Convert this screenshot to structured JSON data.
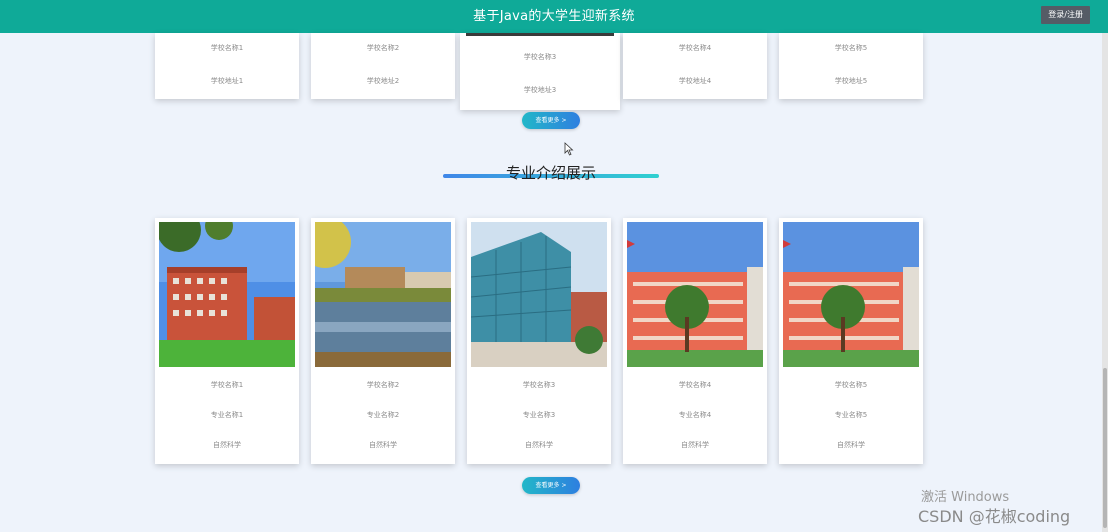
{
  "header": {
    "title": "基于Java的大学生迎新系统",
    "login_label": "登录/注册"
  },
  "schools": [
    {
      "name": "学校名称1",
      "address": "学校地址1"
    },
    {
      "name": "学校名称2",
      "address": "学校地址2"
    },
    {
      "name": "学校名称3",
      "address": "学校地址3"
    },
    {
      "name": "学校名称4",
      "address": "学校地址4"
    },
    {
      "name": "学校名称5",
      "address": "学校地址5"
    }
  ],
  "more_label": "查看更多 >",
  "section": {
    "title": "专业介绍展示"
  },
  "majors": [
    {
      "school": "学校名称1",
      "major": "专业名称1",
      "category": "自然科学"
    },
    {
      "school": "学校名称2",
      "major": "专业名称2",
      "category": "自然科学"
    },
    {
      "school": "学校名称3",
      "major": "专业名称3",
      "category": "自然科学"
    },
    {
      "school": "学校名称4",
      "major": "专业名称4",
      "category": "自然科学"
    },
    {
      "school": "学校名称5",
      "major": "专业名称5",
      "category": "自然科学"
    }
  ],
  "watermark": {
    "windows": "激活 Windows",
    "csdn": "CSDN @花椒coding"
  },
  "colors": {
    "header_bg": "#0faa98",
    "page_bg": "#eef3fb",
    "accent_gradient_start": "#22b7c8",
    "accent_gradient_end": "#2e7fe0"
  }
}
